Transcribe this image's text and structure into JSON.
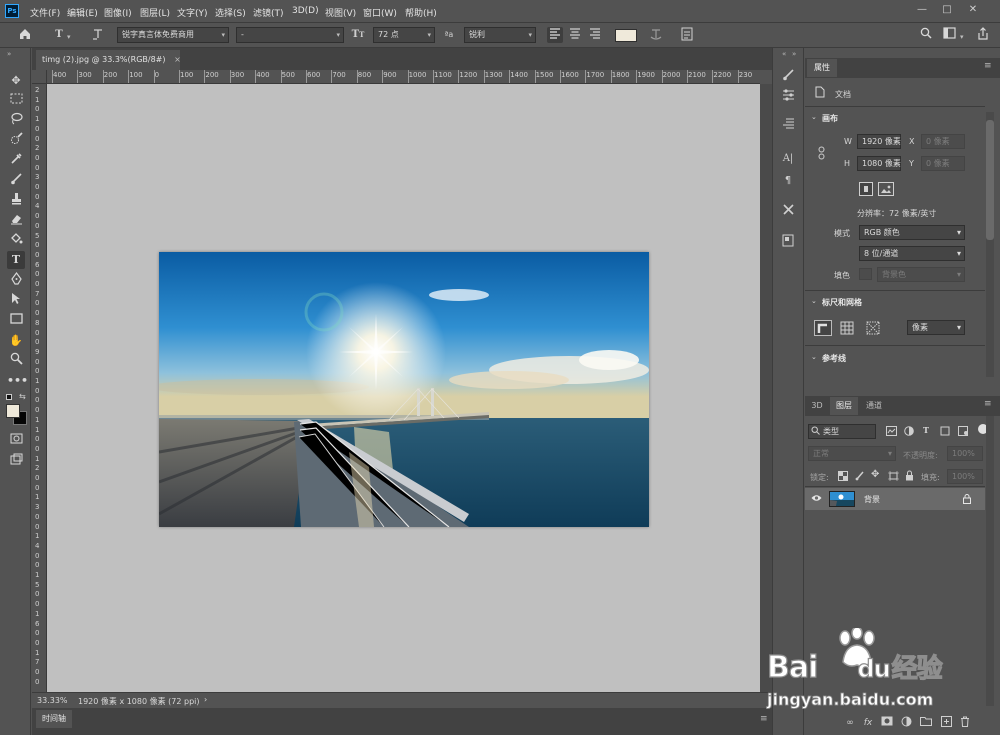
{
  "app": {
    "logo": "Ps"
  },
  "menu": [
    "文件(F)",
    "编辑(E)",
    "图像(I)",
    "图层(L)",
    "文字(Y)",
    "选择(S)",
    "滤镜(T)",
    "3D(D)",
    "视图(V)",
    "窗口(W)",
    "帮助(H)"
  ],
  "window_controls": {
    "minimize": "—",
    "maximize": "□",
    "close": "✕"
  },
  "options": {
    "tool_glyph": "T",
    "font_family": "锐字真言体免费商用",
    "font_style": "-",
    "font_size": "72 点",
    "aa_label": "ªa",
    "antialias": "锐利",
    "text_color": "#efe9da"
  },
  "document_tab": {
    "title": "timg (2).jpg @ 33.3%(RGB/8#)",
    "close": "×"
  },
  "ruler": {
    "h_labels": [
      "400",
      "300",
      "200",
      "100",
      "0",
      "100",
      "200",
      "300",
      "400",
      "500",
      "600",
      "700",
      "800",
      "900",
      "1000",
      "1100",
      "1200",
      "1300",
      "1400",
      "1500",
      "1600",
      "1700",
      "1800",
      "1900",
      "2000",
      "2100",
      "2200",
      "230"
    ],
    "v_labels": [
      "2",
      "1",
      "0",
      "1",
      "0",
      "0",
      "2",
      "0",
      "0",
      "3",
      "0",
      "0",
      "4",
      "0",
      "0",
      "5",
      "0",
      "0",
      "6",
      "0",
      "0",
      "7",
      "0",
      "0",
      "8",
      "0",
      "0",
      "9",
      "0",
      "0",
      "1",
      "0",
      "0",
      "0",
      "1",
      "1",
      "0",
      "0",
      "1",
      "2",
      "0",
      "0",
      "1",
      "3",
      "0",
      "0",
      "1",
      "4",
      "0",
      "0",
      "1",
      "5",
      "0",
      "0",
      "1",
      "6",
      "0",
      "0",
      "1",
      "7",
      "0",
      "0"
    ]
  },
  "status": {
    "zoom": "33.33%",
    "info": "1920 像素 x 1080 像素 (72 ppi)",
    "arrow": "›"
  },
  "timeline": {
    "tab": "时间轴"
  },
  "properties": {
    "tab": "属性",
    "doc_label": "文档",
    "canvas_section": "画布",
    "width": "1920 像素",
    "height": "1080 像素",
    "w_label": "W",
    "h_label": "H",
    "x_label": "X",
    "y_label": "Y",
    "x_value": "0 像素",
    "y_value": "0 像素",
    "resolution": "分辨率：72 像素/英寸",
    "mode_label": "模式",
    "mode": "RGB 颜色",
    "depth": "8 位/通道",
    "fill_label": "填色",
    "fill_value": "背景色",
    "rulers_section": "标尺和网格",
    "ruler_units": "像素",
    "guides_section": "参考线"
  },
  "layers_panel": {
    "tabs": [
      "3D",
      "图层",
      "通道"
    ],
    "search_placeholder": "类型",
    "blend_mode": "正常",
    "opacity_label": "不透明度:",
    "opacity": "100%",
    "lock_label": "锁定:",
    "fill_label": "填充:",
    "fill": "100%",
    "layers": [
      {
        "name": "背景",
        "visible": true,
        "locked": true
      }
    ]
  },
  "watermark": {
    "brand_a": "Bai",
    "brand_b": "du",
    "brand_cn": "经验",
    "url": "jingyan.baidu.com"
  }
}
